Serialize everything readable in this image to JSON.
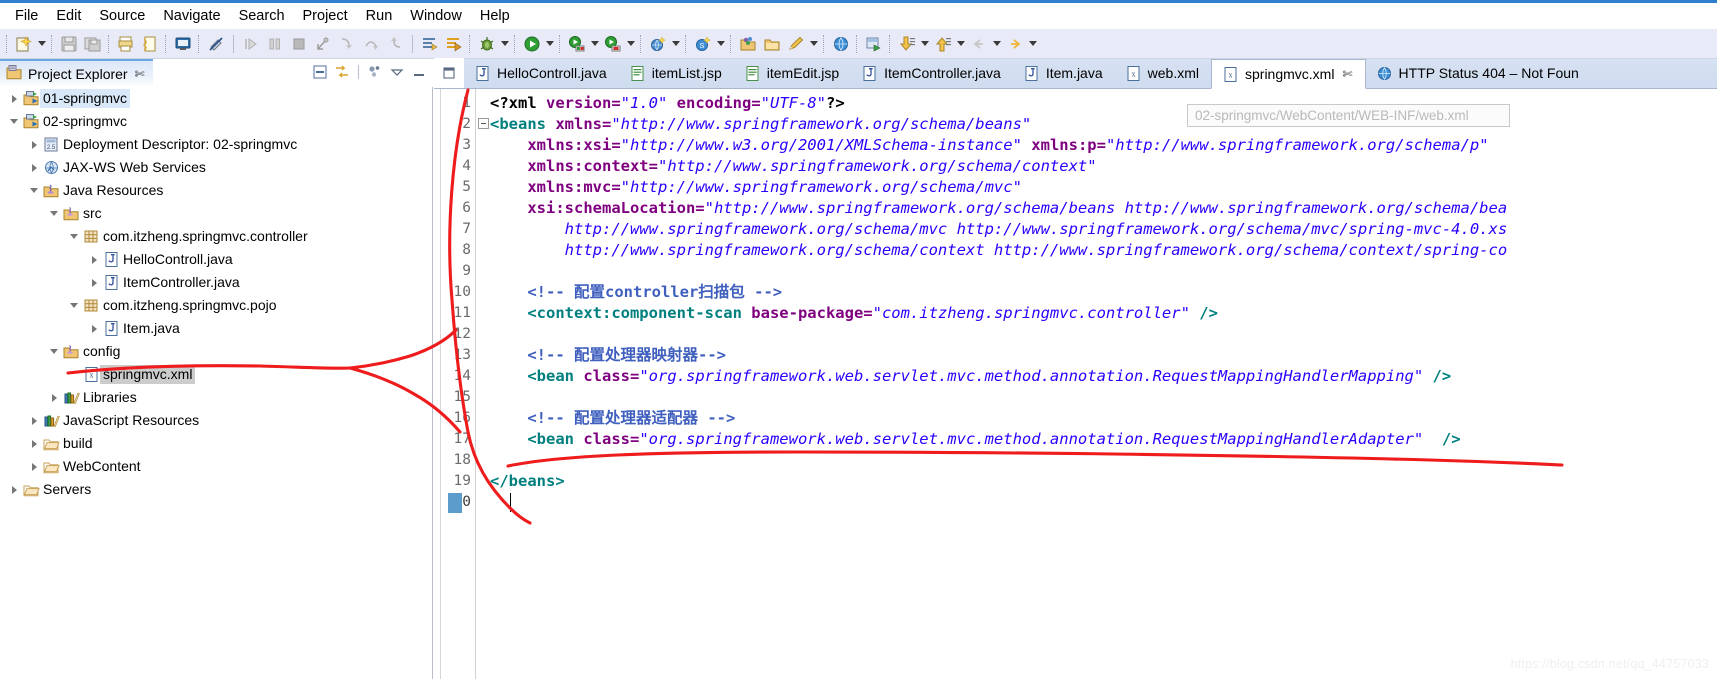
{
  "app": {
    "title": "Eclipse IDE",
    "accent": "#2f7fd1"
  },
  "menubar": {
    "items": [
      {
        "label": "File"
      },
      {
        "label": "Edit"
      },
      {
        "label": "Source"
      },
      {
        "label": "Navigate"
      },
      {
        "label": "Search"
      },
      {
        "label": "Project"
      },
      {
        "label": "Run"
      },
      {
        "label": "Window"
      },
      {
        "label": "Help"
      }
    ]
  },
  "toolbar": {
    "icons": [
      "new-wizard-icon",
      "save-icon",
      "save-all-icon",
      "print-icon",
      "export-icon",
      "console-icon",
      "toggle-breakpoint-icon",
      "resume-icon",
      "suspend-icon",
      "terminate-icon",
      "disconnect-icon",
      "step-into-icon",
      "step-over-icon",
      "step-return-icon",
      "open-type-icon",
      "open-task-icon",
      "debug-icon",
      "run-icon",
      "run-server-icon",
      "stop-server-icon",
      "new-xml-icon",
      "new-spring-icon",
      "open-folder-icon",
      "open-package-icon",
      "edit-icon",
      "web-browser-icon",
      "run-as-server-icon",
      "previous-annotation-icon",
      "next-annotation-icon",
      "back-icon"
    ]
  },
  "project_explorer": {
    "title": "Project Explorer",
    "close_glyph": "✄",
    "tools": [
      "collapse-all-icon",
      "link-with-editor-icon",
      "view-menu-icon",
      "minimize-icon",
      "maximize-icon"
    ],
    "tree": [
      {
        "label": "01-springmvc",
        "depth": 0,
        "state": "collapsed",
        "icon": "project-icon",
        "highlight": "blue"
      },
      {
        "label": "02-springmvc",
        "depth": 0,
        "state": "expanded",
        "icon": "project-icon",
        "highlight": "none"
      },
      {
        "label": "Deployment Descriptor: 02-springmvc",
        "depth": 1,
        "state": "collapsed",
        "icon": "deployment-descriptor-icon",
        "highlight": "none"
      },
      {
        "label": "JAX-WS Web Services",
        "depth": 1,
        "state": "collapsed",
        "icon": "jaxws-icon",
        "highlight": "none"
      },
      {
        "label": "Java Resources",
        "depth": 1,
        "state": "expanded",
        "icon": "java-resources-icon",
        "highlight": "none"
      },
      {
        "label": "src",
        "depth": 2,
        "state": "expanded",
        "icon": "source-folder-icon",
        "highlight": "none"
      },
      {
        "label": "com.itzheng.springmvc.controller",
        "depth": 3,
        "state": "expanded",
        "icon": "package-icon",
        "highlight": "none"
      },
      {
        "label": "HelloControll.java",
        "depth": 4,
        "state": "collapsed",
        "icon": "java-file-icon",
        "highlight": "none"
      },
      {
        "label": "ItemController.java",
        "depth": 4,
        "state": "collapsed",
        "icon": "java-file-icon",
        "highlight": "none"
      },
      {
        "label": "com.itzheng.springmvc.pojo",
        "depth": 3,
        "state": "expanded",
        "icon": "package-icon",
        "highlight": "none"
      },
      {
        "label": "Item.java",
        "depth": 4,
        "state": "collapsed",
        "icon": "java-file-icon",
        "highlight": "none"
      },
      {
        "label": "config",
        "depth": 2,
        "state": "expanded",
        "icon": "source-folder-icon",
        "highlight": "none"
      },
      {
        "label": "springmvc.xml",
        "depth": 3,
        "state": "leaf",
        "icon": "xml-file-icon",
        "highlight": "gray"
      },
      {
        "label": "Libraries",
        "depth": 2,
        "state": "collapsed",
        "icon": "libraries-icon",
        "highlight": "none"
      },
      {
        "label": "JavaScript Resources",
        "depth": 1,
        "state": "collapsed",
        "icon": "libraries-icon",
        "highlight": "none"
      },
      {
        "label": "build",
        "depth": 1,
        "state": "collapsed",
        "icon": "folder-icon",
        "highlight": "none"
      },
      {
        "label": "WebContent",
        "depth": 1,
        "state": "collapsed",
        "icon": "folder-icon",
        "highlight": "none"
      },
      {
        "label": "Servers",
        "depth": 0,
        "state": "collapsed",
        "icon": "folder-icon",
        "highlight": "none"
      }
    ]
  },
  "editor": {
    "tabs": [
      {
        "label": "HelloControll.java",
        "icon": "java-file-icon",
        "active": false,
        "closable": false
      },
      {
        "label": "itemList.jsp",
        "icon": "jsp-file-icon",
        "active": false,
        "closable": false
      },
      {
        "label": "itemEdit.jsp",
        "icon": "jsp-file-icon",
        "active": false,
        "closable": false
      },
      {
        "label": "ItemController.java",
        "icon": "java-file-icon",
        "active": false,
        "closable": false
      },
      {
        "label": "Item.java",
        "icon": "java-file-icon",
        "active": false,
        "closable": false
      },
      {
        "label": "web.xml",
        "icon": "xml-file-icon",
        "active": false,
        "closable": false
      },
      {
        "label": "springmvc.xml",
        "icon": "xml-file-icon",
        "active": true,
        "closable": true
      },
      {
        "label": "HTTP Status 404 – Not Foun",
        "icon": "browser-icon",
        "active": false,
        "closable": false
      }
    ],
    "tooltip": "02-springmvc/WebContent/WEB-INF/web.xml",
    "cursor_line": 20,
    "total_lines": 20,
    "lines": [
      {
        "n": 1,
        "folding": false,
        "tokens": [
          {
            "t": "<?xml ",
            "c": "s-decl"
          },
          {
            "t": "version=",
            "c": "s-attr"
          },
          {
            "t": "\"1.0\"",
            "c": "s-val"
          },
          {
            "t": " ",
            "c": "s-plain"
          },
          {
            "t": "encoding=",
            "c": "s-attr"
          },
          {
            "t": "\"UTF-8\"",
            "c": "s-val"
          },
          {
            "t": "?>",
            "c": "s-decl"
          }
        ]
      },
      {
        "n": 2,
        "folding": true,
        "tokens": [
          {
            "t": "<beans ",
            "c": "s-tag"
          },
          {
            "t": "xmlns=",
            "c": "s-attr"
          },
          {
            "t": "\"http://www.springframework.org/schema/beans\"",
            "c": "s-val"
          }
        ]
      },
      {
        "n": 3,
        "folding": false,
        "tokens": [
          {
            "t": "    ",
            "c": "s-plain"
          },
          {
            "t": "xmlns:xsi=",
            "c": "s-attr"
          },
          {
            "t": "\"http://www.w3.org/2001/XMLSchema-instance\"",
            "c": "s-val"
          },
          {
            "t": " ",
            "c": "s-plain"
          },
          {
            "t": "xmlns:p=",
            "c": "s-attr"
          },
          {
            "t": "\"http://www.springframework.org/schema/p\"",
            "c": "s-val"
          }
        ]
      },
      {
        "n": 4,
        "folding": false,
        "tokens": [
          {
            "t": "    ",
            "c": "s-plain"
          },
          {
            "t": "xmlns:context=",
            "c": "s-attr"
          },
          {
            "t": "\"http://www.springframework.org/schema/context\"",
            "c": "s-val"
          }
        ]
      },
      {
        "n": 5,
        "folding": false,
        "tokens": [
          {
            "t": "    ",
            "c": "s-plain"
          },
          {
            "t": "xmlns:mvc=",
            "c": "s-attr"
          },
          {
            "t": "\"http://www.springframework.org/schema/mvc\"",
            "c": "s-val"
          }
        ]
      },
      {
        "n": 6,
        "folding": false,
        "tokens": [
          {
            "t": "    ",
            "c": "s-plain"
          },
          {
            "t": "xsi:schemaLocation=",
            "c": "s-attr"
          },
          {
            "t": "\"http://www.springframework.org/schema/beans http://www.springframework.org/schema/bea",
            "c": "s-val"
          }
        ]
      },
      {
        "n": 7,
        "folding": false,
        "tokens": [
          {
            "t": "        ",
            "c": "s-plain"
          },
          {
            "t": "http://www.springframework.org/schema/mvc http://www.springframework.org/schema/mvc/spring-mvc-4.0.xs",
            "c": "s-val"
          }
        ]
      },
      {
        "n": 8,
        "folding": false,
        "tokens": [
          {
            "t": "        ",
            "c": "s-plain"
          },
          {
            "t": "http://www.springframework.org/schema/context http://www.springframework.org/schema/context/spring-co",
            "c": "s-val"
          }
        ]
      },
      {
        "n": 9,
        "folding": false,
        "tokens": []
      },
      {
        "n": 10,
        "folding": false,
        "tokens": [
          {
            "t": "    ",
            "c": "s-plain"
          },
          {
            "t": "<!-- 配置controller扫描包 -->",
            "c": "s-cmt"
          }
        ]
      },
      {
        "n": 11,
        "folding": false,
        "tokens": [
          {
            "t": "    ",
            "c": "s-plain"
          },
          {
            "t": "<context:component-scan ",
            "c": "s-tag"
          },
          {
            "t": "base-package=",
            "c": "s-attr"
          },
          {
            "t": "\"com.itzheng.springmvc.controller\"",
            "c": "s-val"
          },
          {
            "t": " />",
            "c": "s-tag"
          }
        ]
      },
      {
        "n": 12,
        "folding": false,
        "tokens": []
      },
      {
        "n": 13,
        "folding": false,
        "tokens": [
          {
            "t": "    ",
            "c": "s-plain"
          },
          {
            "t": "<!-- 配置处理器映射器-->",
            "c": "s-cmt"
          }
        ]
      },
      {
        "n": 14,
        "folding": false,
        "tokens": [
          {
            "t": "    ",
            "c": "s-plain"
          },
          {
            "t": "<bean ",
            "c": "s-tag"
          },
          {
            "t": "class=",
            "c": "s-attr"
          },
          {
            "t": "\"org.springframework.web.servlet.mvc.method.annotation.RequestMappingHandlerMapping\"",
            "c": "s-val"
          },
          {
            "t": " />",
            "c": "s-tag"
          }
        ]
      },
      {
        "n": 15,
        "folding": false,
        "tokens": []
      },
      {
        "n": 16,
        "folding": false,
        "tokens": [
          {
            "t": "    ",
            "c": "s-plain"
          },
          {
            "t": "<!-- 配置处理器适配器 -->",
            "c": "s-cmt"
          }
        ]
      },
      {
        "n": 17,
        "folding": false,
        "tokens": [
          {
            "t": "    ",
            "c": "s-plain"
          },
          {
            "t": "<bean ",
            "c": "s-tag"
          },
          {
            "t": "class=",
            "c": "s-attr"
          },
          {
            "t": "\"org.springframework.web.servlet.mvc.method.annotation.RequestMappingHandlerAdapter\"",
            "c": "s-val"
          },
          {
            "t": "  />",
            "c": "s-tag"
          }
        ]
      },
      {
        "n": 18,
        "folding": false,
        "tokens": []
      },
      {
        "n": 19,
        "folding": false,
        "tokens": [
          {
            "t": "</beans>",
            "c": "s-tag"
          }
        ]
      },
      {
        "n": 20,
        "folding": false,
        "tokens": []
      }
    ]
  },
  "annotations": {
    "color": "#ee1c1c",
    "description": "hand-drawn red marker connecting springmvc.xml in the tree to the editor content"
  },
  "watermark": "https://blog.csdn.net/qq_44757033"
}
